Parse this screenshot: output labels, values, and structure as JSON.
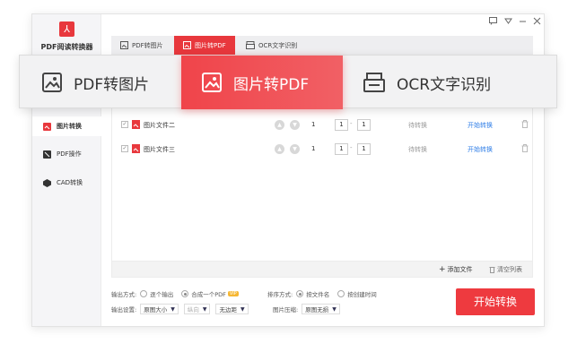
{
  "app": {
    "title": "PDF阅读转换器"
  },
  "window_controls": [
    "feedback-icon",
    "menu-icon",
    "minimize-icon",
    "close-icon"
  ],
  "sidebar": {
    "items": [
      {
        "label": "图片转换",
        "icon": "image-convert-icon",
        "active": true
      },
      {
        "label": "PDF操作",
        "icon": "pdf-ops-icon",
        "active": false
      },
      {
        "label": "CAD转换",
        "icon": "cad-icon",
        "active": false
      }
    ]
  },
  "tabs": [
    {
      "label": "PDF转图片",
      "active": false
    },
    {
      "label": "图片转PDF",
      "active": true
    },
    {
      "label": "OCR文字识别",
      "active": false
    }
  ],
  "overlay_tabs": [
    {
      "label": "PDF转图片",
      "active": false
    },
    {
      "label": "图片转PDF",
      "active": true
    },
    {
      "label": "OCR文字识别",
      "active": false
    }
  ],
  "files": [
    {
      "name": "图片文件二",
      "pages": "1",
      "from": "1",
      "to": "1",
      "status": "待转换",
      "action": "开始转换"
    },
    {
      "name": "图片文件三",
      "pages": "1",
      "from": "1",
      "to": "1",
      "status": "待转换",
      "action": "开始转换"
    }
  ],
  "file_actions": {
    "add": "添加文件",
    "clear": "清空列表"
  },
  "settings": {
    "output_mode_label": "输出方式:",
    "output_mode_options": [
      "逐个输出",
      "合成一个PDF"
    ],
    "vip": "VIP",
    "sort_label": "排序方式:",
    "sort_options": [
      "按文件名",
      "按创建时间"
    ],
    "output_settings_label": "输出设置:",
    "size_value": "原图大小",
    "orientation_value": "纵向",
    "margin_value": "无边距",
    "compress_label": "图片压缩:",
    "compress_value": "原图无损"
  },
  "start_button": "开始转换",
  "colors": {
    "accent": "#ee3a3f",
    "link": "#2f7ee7"
  }
}
